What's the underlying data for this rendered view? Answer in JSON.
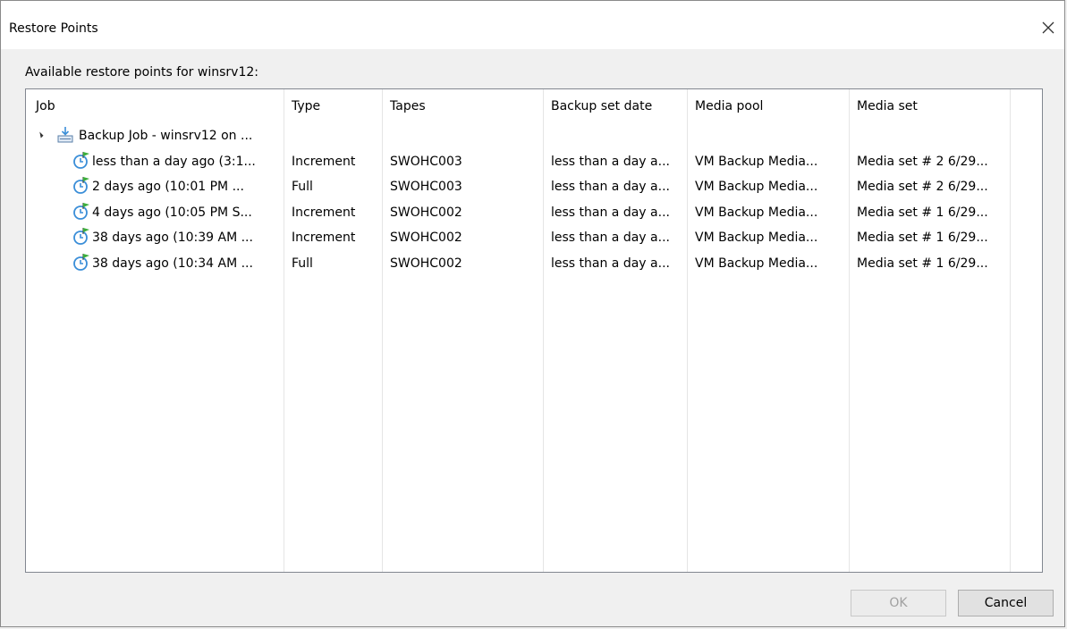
{
  "window": {
    "title": "Restore Points"
  },
  "subtitle": "Available restore points for winsrv12:",
  "columns": [
    "Job",
    "Type",
    "Tapes",
    "Backup set date",
    "Media pool",
    "Media set"
  ],
  "job_row": {
    "label": "Backup Job - winsrv12 on ..."
  },
  "rows": [
    {
      "job": "less than a day ago (3:1...",
      "type": "Increment",
      "tapes": "SWOHC003",
      "date": "less than a day a...",
      "pool": "VM Backup Media...",
      "set": "Media set # 2 6/29..."
    },
    {
      "job": "2 days ago (10:01 PM ...",
      "type": "Full",
      "tapes": "SWOHC003",
      "date": "less than a day a...",
      "pool": "VM Backup Media...",
      "set": "Media set # 2 6/29..."
    },
    {
      "job": "4 days ago (10:05 PM S...",
      "type": "Increment",
      "tapes": "SWOHC002",
      "date": "less than a day a...",
      "pool": "VM Backup Media...",
      "set": "Media set # 1 6/29..."
    },
    {
      "job": "38 days ago (10:39 AM ...",
      "type": "Increment",
      "tapes": "SWOHC002",
      "date": "less than a day a...",
      "pool": "VM Backup Media...",
      "set": "Media set # 1 6/29..."
    },
    {
      "job": "38 days ago (10:34 AM ...",
      "type": "Full",
      "tapes": "SWOHC002",
      "date": "less than a day a...",
      "pool": "VM Backup Media...",
      "set": "Media set # 1 6/29..."
    }
  ],
  "buttons": {
    "ok": "OK",
    "cancel": "Cancel"
  },
  "colors": {
    "accent_blue": "#3a8ed8",
    "flag_green": "#3cae3c",
    "grid_line": "#e5e5e5"
  }
}
